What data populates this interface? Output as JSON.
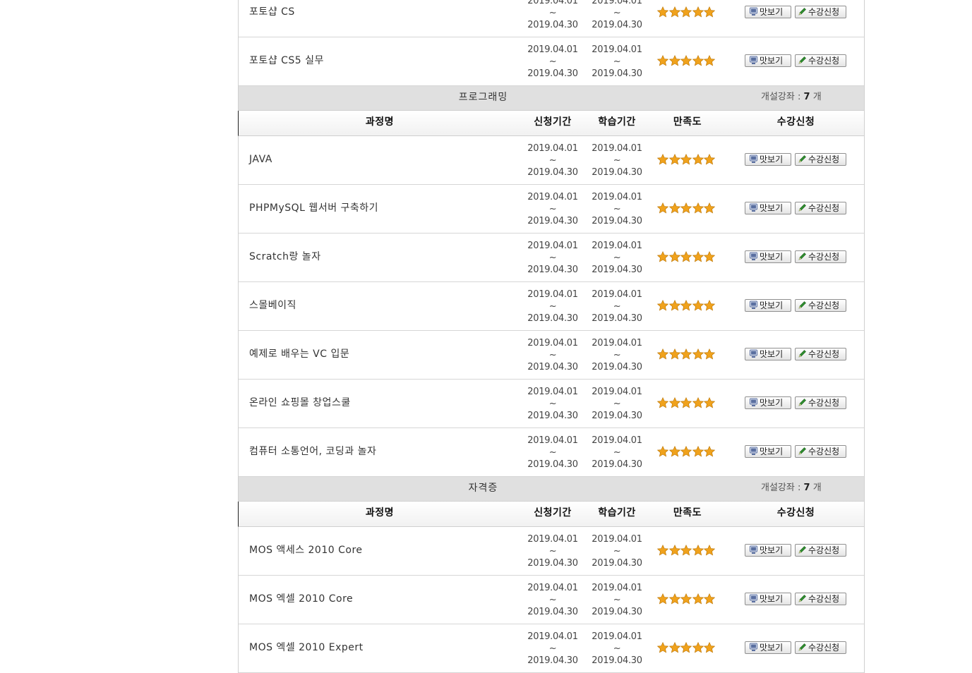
{
  "labels": {
    "tilde": "~",
    "count_prefix": "개설강좌 :",
    "count_suffix": "개"
  },
  "columns": {
    "name": "과정명",
    "apply_period": "신청기간",
    "study_period": "학습기간",
    "satisfaction": "만족도",
    "register": "수강신청"
  },
  "buttons": {
    "preview": "맛보기",
    "register": "수강신청"
  },
  "colors": {
    "star": "#f0a21c",
    "category_bg": "#e0e0e0",
    "pencil": "#2f8f2f",
    "monitor": "#5a6fa0"
  },
  "top_courses": [
    {
      "name": "포토샵 CS",
      "apply_start": "2019.04.01",
      "apply_end": "2019.04.30",
      "study_start": "2019.04.01",
      "study_end": "2019.04.30",
      "rating": 5
    },
    {
      "name": "포토샵 CS5 실무",
      "apply_start": "2019.04.01",
      "apply_end": "2019.04.30",
      "study_start": "2019.04.01",
      "study_end": "2019.04.30",
      "rating": 5
    }
  ],
  "categories": [
    {
      "title": "프로그래밍",
      "count": "7",
      "courses": [
        {
          "name": "JAVA",
          "apply_start": "2019.04.01",
          "apply_end": "2019.04.30",
          "study_start": "2019.04.01",
          "study_end": "2019.04.30",
          "rating": 5
        },
        {
          "name": "PHPMySQL 웹서버 구축하기",
          "apply_start": "2019.04.01",
          "apply_end": "2019.04.30",
          "study_start": "2019.04.01",
          "study_end": "2019.04.30",
          "rating": 5
        },
        {
          "name": "Scratch랑 놀자",
          "apply_start": "2019.04.01",
          "apply_end": "2019.04.30",
          "study_start": "2019.04.01",
          "study_end": "2019.04.30",
          "rating": 5
        },
        {
          "name": "스몰베이직",
          "apply_start": "2019.04.01",
          "apply_end": "2019.04.30",
          "study_start": "2019.04.01",
          "study_end": "2019.04.30",
          "rating": 5
        },
        {
          "name": "예제로 배우는 VC 입문",
          "apply_start": "2019.04.01",
          "apply_end": "2019.04.30",
          "study_start": "2019.04.01",
          "study_end": "2019.04.30",
          "rating": 5
        },
        {
          "name": "온라인 쇼핑몰 창업스쿨",
          "apply_start": "2019.04.01",
          "apply_end": "2019.04.30",
          "study_start": "2019.04.01",
          "study_end": "2019.04.30",
          "rating": 5
        },
        {
          "name": "컴퓨터 소통언어, 코딩과 놀자",
          "apply_start": "2019.04.01",
          "apply_end": "2019.04.30",
          "study_start": "2019.04.01",
          "study_end": "2019.04.30",
          "rating": 5
        }
      ]
    },
    {
      "title": "자격증",
      "count": "7",
      "courses": [
        {
          "name": "MOS 액세스 2010 Core",
          "apply_start": "2019.04.01",
          "apply_end": "2019.04.30",
          "study_start": "2019.04.01",
          "study_end": "2019.04.30",
          "rating": 5
        },
        {
          "name": "MOS 엑셀 2010 Core",
          "apply_start": "2019.04.01",
          "apply_end": "2019.04.30",
          "study_start": "2019.04.01",
          "study_end": "2019.04.30",
          "rating": 5
        },
        {
          "name": "MOS 엑셀 2010 Expert",
          "apply_start": "2019.04.01",
          "apply_end": "2019.04.30",
          "study_start": "2019.04.01",
          "study_end": "2019.04.30",
          "rating": 5
        }
      ]
    }
  ]
}
